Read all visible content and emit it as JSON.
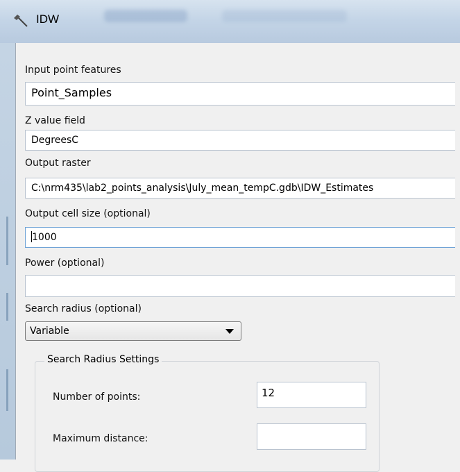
{
  "window": {
    "title": "IDW",
    "icon": "hammer-icon"
  },
  "form": {
    "input_point_features": {
      "label": "Input point features",
      "value": "Point_Samples"
    },
    "z_value_field": {
      "label": "Z value field",
      "value": "DegreesC"
    },
    "output_raster": {
      "label": "Output raster",
      "value": "C:\\nrm435\\lab2_points_analysis\\July_mean_tempC.gdb\\IDW_Estimates"
    },
    "output_cell_size": {
      "label": "Output cell size (optional)",
      "value": "1000"
    },
    "power": {
      "label": "Power (optional)",
      "value": ""
    },
    "search_radius": {
      "label": "Search radius (optional)",
      "selected": "Variable"
    },
    "search_radius_settings": {
      "legend": "Search Radius Settings",
      "number_of_points": {
        "label": "Number of points:",
        "value": "12"
      },
      "maximum_distance": {
        "label": "Maximum distance:",
        "value": ""
      }
    }
  },
  "colors": {
    "frame": "#bccfe2",
    "content_bg": "#f0f0f0",
    "focus_border": "#6fa3d6"
  }
}
